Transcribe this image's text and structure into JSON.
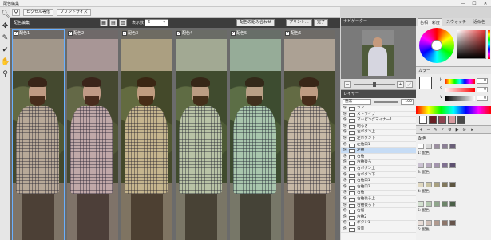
{
  "window": {
    "title": "配色編集",
    "controls": [
      "—",
      "☐",
      "✕"
    ]
  },
  "left_tools": [
    {
      "name": "zoom-tool-icon",
      "glyph": "🔍︎"
    },
    {
      "name": "move-tool-icon",
      "glyph": "✥"
    },
    {
      "name": "eyedropper-tool-icon",
      "glyph": "✎"
    },
    {
      "name": "check-tool-icon",
      "glyph": "✔"
    },
    {
      "name": "hand-tool-icon",
      "glyph": "✋"
    },
    {
      "name": "magnifier-tool-icon",
      "glyph": "⚲"
    }
  ],
  "toolbar": {
    "pixel_size": "ピクセル等倍",
    "print_size": "プリントサイズ"
  },
  "preview_bar": {
    "label": "配色編集",
    "count_label": "表示数",
    "count_value": "6",
    "apply_button": "配色の組み合わせ",
    "print_button": "プリント...",
    "done_button": "完了"
  },
  "photos": [
    {
      "label": "配色1",
      "tint": "#b8a998",
      "checked": true
    },
    {
      "label": "配色2",
      "tint": "#c0a8a8",
      "checked": true
    },
    {
      "label": "配色3",
      "tint": "#c5b58e",
      "checked": true
    },
    {
      "label": "配色4",
      "tint": "#b9c3a6",
      "checked": true
    },
    {
      "label": "配色5",
      "tint": "#a9c6ad",
      "checked": true
    },
    {
      "label": "配色6",
      "tint": "#c6b8a6",
      "checked": true
    }
  ],
  "navigator": {
    "title": "ナビゲーター"
  },
  "layers": {
    "title": "レイヤー",
    "blend": "通常",
    "opacity": "100",
    "items": [
      "ラフ",
      "ストライプ",
      "マッピングマイナー1",
      "明るさ",
      "左ボタン上",
      "左ボタン下",
      "左袖口1",
      "左袖",
      "右袖",
      "右袖後ろ",
      "右ボタン上",
      "右ボタン下",
      "右袖口1",
      "右袖口2",
      "右袖",
      "右袖後ろ上",
      "右袖後ろ下",
      "右裾",
      "右袖2",
      "ボタン1",
      "背景"
    ],
    "selected_index": 7
  },
  "color_panel": {
    "tabs": [
      "色相・彩度",
      "スウォッチ",
      "近似色"
    ],
    "active_tab": 0,
    "section": "カラー",
    "slider_values": [
      "0",
      "0",
      "0"
    ],
    "slider_labels": [
      "H",
      "S",
      "V"
    ],
    "recent": [
      "#ffffff",
      "#6a1f24",
      "#8e4450",
      "#d69a9f",
      "#4a4a4a"
    ]
  },
  "set_panel": {
    "title": "配色",
    "groups": [
      {
        "label": "1: 配色",
        "swatches": [
          "#ffffff",
          "#d9d9d9",
          "#9b8fa0",
          "#8b7f95",
          "#6a5f78"
        ]
      },
      {
        "label": "3: 配色",
        "swatches": [
          "#c9c0d0",
          "#b5a8bd",
          "#a394ad",
          "#7f7090",
          "#5d5070"
        ]
      },
      {
        "label": "4: 配色",
        "swatches": [
          "#e0d8c0",
          "#c9c3a2",
          "#a8a080",
          "#81785d",
          "#5d5540"
        ]
      },
      {
        "label": "5: 配色",
        "swatches": [
          "#d3e0d0",
          "#b4c8b0",
          "#90a68c",
          "#6d856a",
          "#4b5f48"
        ]
      },
      {
        "label": "6: 配色",
        "swatches": [
          "#e8ddd8",
          "#cfbeb6",
          "#b09a8f",
          "#8c766b",
          "#66544b"
        ]
      }
    ]
  }
}
